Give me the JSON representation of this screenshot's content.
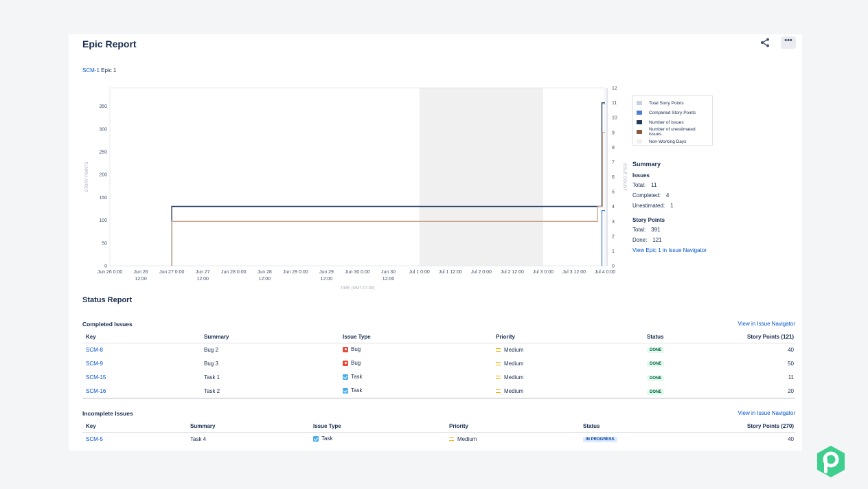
{
  "page": {
    "title": "Epic Report",
    "epic_key": "SCM-1",
    "epic_name": "Epic 1",
    "more_label": "•••"
  },
  "chart_data": {
    "type": "line",
    "ylabel": "STORY POINTS",
    "y2label": "ISSUE COUNT",
    "xlabel": "TIME (GMT-07:00)",
    "ylim": [
      0,
      390
    ],
    "y2lim": [
      0,
      12
    ],
    "yticks": [
      0,
      50,
      100,
      150,
      200,
      250,
      300,
      350
    ],
    "y2ticks": [
      0,
      1,
      2,
      3,
      4,
      5,
      6,
      7,
      8,
      9,
      10,
      11,
      12
    ],
    "xlim_days": [
      0,
      8
    ],
    "xticks": [
      {
        "d": 0,
        "l1": "Jun 26 0:00",
        "l2": ""
      },
      {
        "d": 0.5,
        "l1": "Jun 26",
        "l2": "12:00"
      },
      {
        "d": 1,
        "l1": "Jun 27 0:00",
        "l2": ""
      },
      {
        "d": 1.5,
        "l1": "Jun 27",
        "l2": "12:00"
      },
      {
        "d": 2,
        "l1": "Jun 28 0:00",
        "l2": ""
      },
      {
        "d": 2.5,
        "l1": "Jun 28",
        "l2": "12:00"
      },
      {
        "d": 3,
        "l1": "Jun 29 0:00",
        "l2": ""
      },
      {
        "d": 3.5,
        "l1": "Jun 29",
        "l2": "12:00"
      },
      {
        "d": 4,
        "l1": "Jun 30 0:00",
        "l2": ""
      },
      {
        "d": 4.5,
        "l1": "Jun 30",
        "l2": "12:00"
      },
      {
        "d": 5,
        "l1": "Jul 1 0:00",
        "l2": ""
      },
      {
        "d": 5.5,
        "l1": "Jul 1 12:00",
        "l2": ""
      },
      {
        "d": 6,
        "l1": "Jul 2 0:00",
        "l2": ""
      },
      {
        "d": 6.5,
        "l1": "Jul 2 12:00",
        "l2": ""
      },
      {
        "d": 7,
        "l1": "Jul 3 0:00",
        "l2": ""
      },
      {
        "d": 7.5,
        "l1": "Jul 3 12:00",
        "l2": ""
      },
      {
        "d": 8,
        "l1": "Jul 4 0:00",
        "l2": ""
      }
    ],
    "non_working": [
      [
        5,
        7
      ]
    ],
    "series": [
      {
        "name": "Total Story Points",
        "color": "#9fb9dc",
        "axis": "left",
        "points": [
          [
            1.0,
            0
          ],
          [
            1.0,
            131
          ],
          [
            7.95,
            131
          ],
          [
            7.95,
            355
          ],
          [
            8.0,
            355
          ]
        ]
      },
      {
        "name": "Completed Story Points",
        "color": "#4c7fd1",
        "axis": "left",
        "points": [
          [
            7.95,
            0
          ],
          [
            7.95,
            121
          ],
          [
            8.0,
            121
          ]
        ]
      },
      {
        "name": "Number of issues",
        "color": "#253858",
        "axis": "right",
        "points": [
          [
            1.0,
            0
          ],
          [
            1.0,
            4
          ],
          [
            7.95,
            4
          ],
          [
            7.95,
            11
          ],
          [
            8.0,
            11
          ]
        ]
      },
      {
        "name": "Number of unestimated issues",
        "color": "#c7a48e",
        "axis": "right",
        "points": [
          [
            1.0,
            0
          ],
          [
            1.0,
            3
          ],
          [
            7.88,
            3
          ],
          [
            7.88,
            4
          ],
          [
            7.96,
            4
          ],
          [
            7.96,
            9
          ],
          [
            8.0,
            9
          ]
        ]
      }
    ],
    "legend": [
      {
        "label": "Total Story Points",
        "color": "#c9d1dc"
      },
      {
        "label": "Completed Story Points",
        "color": "#4c7fd1"
      },
      {
        "label": "Number of issues",
        "color": "#253858"
      },
      {
        "label": "Number of unestimated issues",
        "color": "#8a5a3c"
      },
      {
        "label": "Non-Working Days",
        "color": "#f0f0f0"
      }
    ]
  },
  "summary": {
    "title": "Summary",
    "issues_heading": "Issues",
    "total_label": "Total:",
    "total_value": "11",
    "completed_label": "Completed:",
    "completed_value": "4",
    "unestimated_label": "Unestimated:",
    "unestimated_value": "1",
    "sp_heading": "Story Points",
    "sp_total_label": "Total:",
    "sp_total_value": "391",
    "sp_done_label": "Done:",
    "sp_done_value": "121",
    "link": "View Epic 1 in Issue Navigator"
  },
  "status": {
    "title": "Status Report",
    "completed": {
      "title": "Completed Issues",
      "link": "View in Issue Navigator",
      "headers": [
        "Key",
        "Summary",
        "Issue Type",
        "Priority",
        "Status",
        "Story Points (121)"
      ],
      "rows": [
        {
          "key": "SCM-8",
          "summary": "Bug 2",
          "type": "Bug",
          "type_icon": "bug",
          "priority": "Medium",
          "status": "DONE",
          "points": "40"
        },
        {
          "key": "SCM-9",
          "summary": "Bug 3",
          "type": "Bug",
          "type_icon": "bug",
          "priority": "Medium",
          "status": "DONE",
          "points": "50"
        },
        {
          "key": "SCM-15",
          "summary": "Task 1",
          "type": "Task",
          "type_icon": "task",
          "priority": "Medium",
          "status": "DONE",
          "points": "11"
        },
        {
          "key": "SCM-16",
          "summary": "Task 2",
          "type": "Task",
          "type_icon": "task",
          "priority": "Medium",
          "status": "DONE",
          "points": "20"
        }
      ]
    },
    "incomplete": {
      "title": "Incomplete Issues",
      "link": "View in Issue Navigator",
      "headers": [
        "Key",
        "Summary",
        "Issue Type",
        "Priority",
        "Status",
        "Story Points (270)"
      ],
      "rows": [
        {
          "key": "SCM-5",
          "summary": "Task 4",
          "type": "Task",
          "type_icon": "task",
          "priority": "Medium",
          "status": "IN PROGRESS",
          "points": "40"
        }
      ]
    }
  }
}
